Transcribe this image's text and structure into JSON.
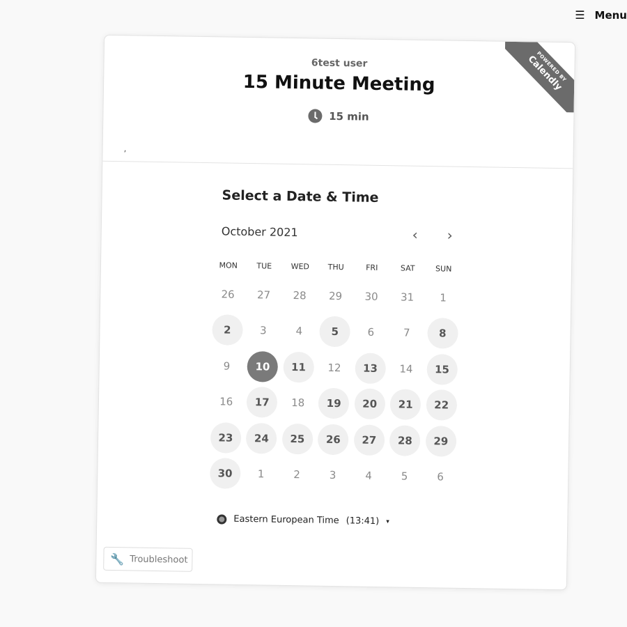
{
  "topbar": {
    "menu_icon": "hamburger-icon",
    "menu_label": "Menu"
  },
  "ribbon": {
    "small": "POWERED BY",
    "brand": "Calendly"
  },
  "event": {
    "organizer": "6test user",
    "title": "15 Minute Meeting",
    "duration_icon": "clock-icon",
    "duration": "15 min",
    "description": ","
  },
  "calendar": {
    "heading": "Select a Date & Time",
    "month": "October 2021",
    "prev_icon": "chevron-left-icon",
    "next_icon": "chevron-right-icon",
    "prev_glyph": "‹",
    "next_glyph": "›",
    "weekdays": [
      "MON",
      "TUE",
      "WED",
      "THU",
      "FRI",
      "SAT",
      "SUN"
    ],
    "days": [
      {
        "label": "26",
        "state": "out"
      },
      {
        "label": "27",
        "state": "out"
      },
      {
        "label": "28",
        "state": "out"
      },
      {
        "label": "29",
        "state": "out"
      },
      {
        "label": "30",
        "state": "out"
      },
      {
        "label": "31",
        "state": "out"
      },
      {
        "label": "1",
        "state": "disabled"
      },
      {
        "label": "2",
        "state": "available"
      },
      {
        "label": "3",
        "state": "disabled"
      },
      {
        "label": "4",
        "state": "disabled"
      },
      {
        "label": "5",
        "state": "available"
      },
      {
        "label": "6",
        "state": "disabled"
      },
      {
        "label": "7",
        "state": "disabled"
      },
      {
        "label": "8",
        "state": "available"
      },
      {
        "label": "9",
        "state": "disabled"
      },
      {
        "label": "10",
        "state": "selected"
      },
      {
        "label": "11",
        "state": "available"
      },
      {
        "label": "12",
        "state": "disabled"
      },
      {
        "label": "13",
        "state": "available"
      },
      {
        "label": "14",
        "state": "disabled"
      },
      {
        "label": "15",
        "state": "available"
      },
      {
        "label": "16",
        "state": "disabled"
      },
      {
        "label": "17",
        "state": "available"
      },
      {
        "label": "18",
        "state": "disabled"
      },
      {
        "label": "19",
        "state": "available"
      },
      {
        "label": "20",
        "state": "available"
      },
      {
        "label": "21",
        "state": "available"
      },
      {
        "label": "22",
        "state": "available"
      },
      {
        "label": "23",
        "state": "available"
      },
      {
        "label": "24",
        "state": "available"
      },
      {
        "label": "25",
        "state": "available"
      },
      {
        "label": "26",
        "state": "available"
      },
      {
        "label": "27",
        "state": "available"
      },
      {
        "label": "28",
        "state": "available"
      },
      {
        "label": "29",
        "state": "available"
      },
      {
        "label": "30",
        "state": "available"
      },
      {
        "label": "1",
        "state": "out"
      },
      {
        "label": "2",
        "state": "out"
      },
      {
        "label": "3",
        "state": "out"
      },
      {
        "label": "4",
        "state": "out"
      },
      {
        "label": "5",
        "state": "out"
      },
      {
        "label": "6",
        "state": "out"
      }
    ]
  },
  "timezone": {
    "icon": "globe-icon",
    "label": "Eastern European Time",
    "time": "(13:41)",
    "caret": "▾"
  },
  "troubleshoot": {
    "icon": "wrench-icon",
    "label": "Troubleshoot"
  },
  "colors": {
    "accent": "#7a7a7a",
    "available_bg": "#f0f0f0"
  }
}
